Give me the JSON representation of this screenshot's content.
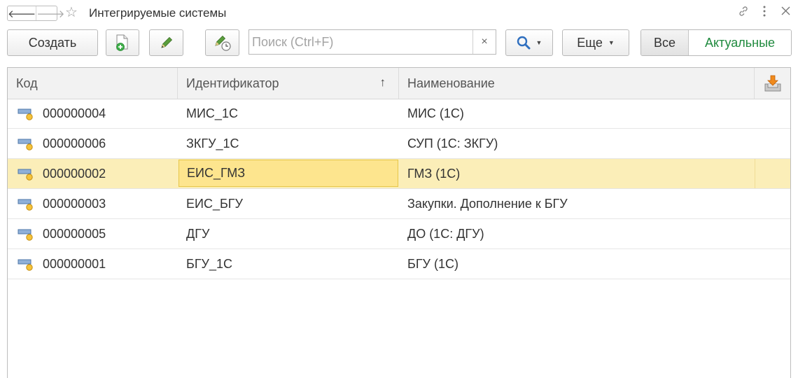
{
  "window": {
    "title": "Интегрируемые системы",
    "nav": {
      "back_icon": "arrow-left-icon",
      "forward_icon": "arrow-right-icon"
    },
    "favorite_icon": "star-icon",
    "link_icon": "link-icon",
    "menu_icon": "kebab-menu-icon",
    "close_icon": "close-icon"
  },
  "toolbar": {
    "create_label": "Создать",
    "search_placeholder": "Поиск (Ctrl+F)",
    "search_clear": "×",
    "more_label": "Еще",
    "filter_all_label": "Все",
    "filter_actual_label": "Актуальные"
  },
  "colors": {
    "accent_green": "#1f8a3e",
    "selected_row": "#fbeeb8",
    "focused_cell": "#fde58e"
  },
  "table": {
    "columns": [
      "Код",
      "Идентификатор",
      "Наименование"
    ],
    "sorted_column": "Идентификатор",
    "sort_indicator": "↑",
    "selected_row_index": 2,
    "rows": [
      {
        "code": "000000004",
        "identifier": "МИС_1С",
        "name": "МИС (1С)"
      },
      {
        "code": "000000006",
        "identifier": "ЗКГУ_1С",
        "name": "СУП (1С: ЗКГУ)"
      },
      {
        "code": "000000002",
        "identifier": "ЕИС_ГМЗ",
        "name": "ГМЗ (1С)"
      },
      {
        "code": "000000003",
        "identifier": "ЕИС_БГУ",
        "name": "Закупки. Дополнение к БГУ"
      },
      {
        "code": "000000005",
        "identifier": "ДГУ",
        "name": "ДО (1С: ДГУ)"
      },
      {
        "code": "000000001",
        "identifier": "БГУ_1С",
        "name": "БГУ (1С)"
      }
    ]
  }
}
